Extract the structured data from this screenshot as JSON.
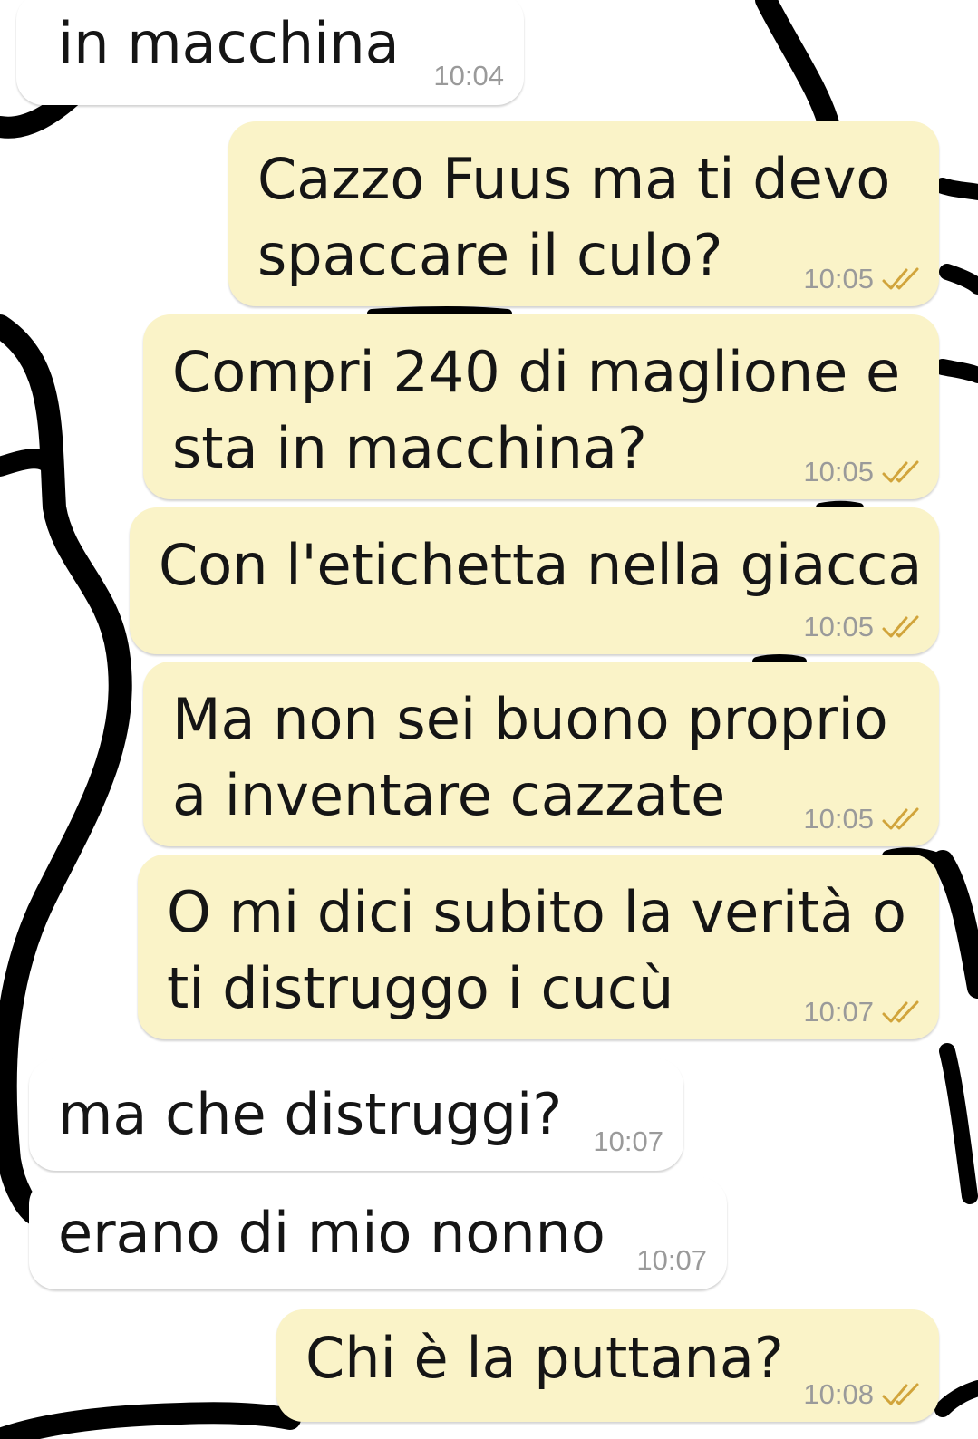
{
  "chat": {
    "messages": [
      {
        "direction": "incoming",
        "lines": [
          "in macchina"
        ],
        "time": "10:04"
      },
      {
        "direction": "outgoing",
        "lines": [
          "Cazzo Fuus ma ti devo",
          "spaccare il culo?"
        ],
        "time": "10:05",
        "status_icon": "double-check-icon"
      },
      {
        "direction": "outgoing",
        "lines": [
          "Compri 240 di maglione e",
          "sta in macchina?"
        ],
        "time": "10:05",
        "status_icon": "double-check-icon"
      },
      {
        "direction": "outgoing",
        "lines": [
          "Con l'etichetta nella giacca"
        ],
        "time": "10:05",
        "status_icon": "double-check-icon"
      },
      {
        "direction": "outgoing",
        "lines": [
          "Ma non sei buono proprio",
          "a inventare cazzate"
        ],
        "time": "10:05",
        "status_icon": "double-check-icon"
      },
      {
        "direction": "outgoing",
        "lines": [
          "O mi dici subito la verità o",
          "ti distruggo i cucù"
        ],
        "time": "10:07",
        "status_icon": "double-check-icon"
      },
      {
        "direction": "incoming",
        "lines": [
          "ma che distruggi?"
        ],
        "time": "10:07"
      },
      {
        "direction": "incoming",
        "lines": [
          "erano di mio nonno"
        ],
        "time": "10:07"
      },
      {
        "direction": "outgoing",
        "lines": [
          "Chi è la puttana?"
        ],
        "time": "10:08",
        "status_icon": "double-check-icon"
      }
    ]
  },
  "colors": {
    "incoming_bubble": "#ffffff",
    "outgoing_bubble": "#faf3c8",
    "text": "#151515",
    "timestamp": "#9a9a9a",
    "tick": "#d1a43b",
    "background_doodle": "#000000"
  }
}
